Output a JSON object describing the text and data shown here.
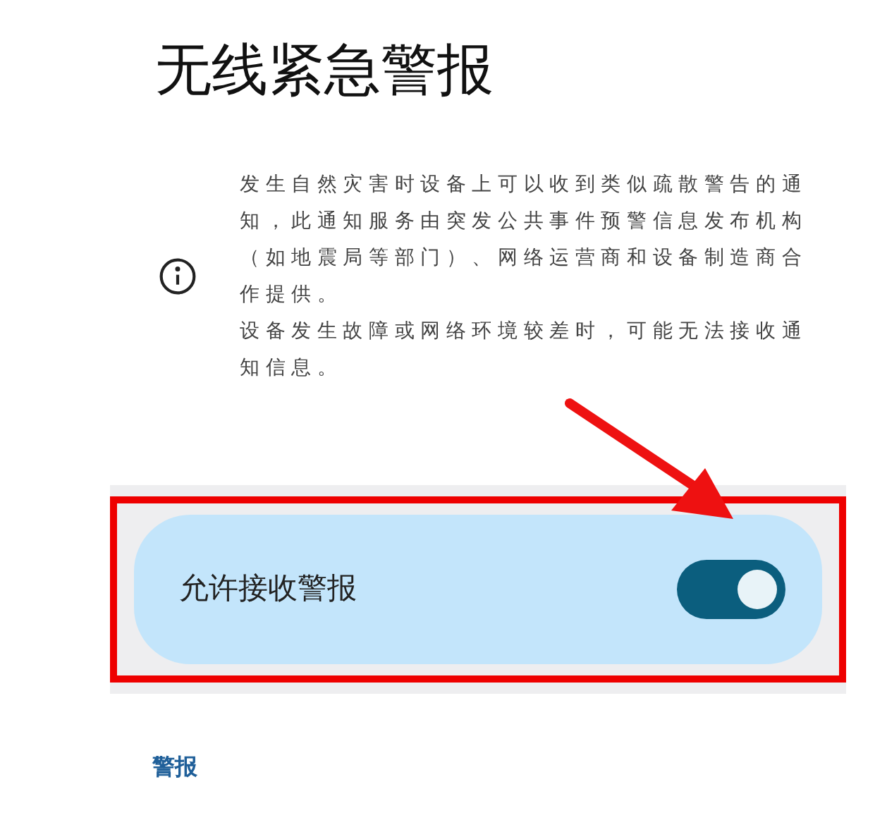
{
  "title": "无线紧急警报",
  "info": [
    "发生自然灾害时设备上可以收到类似疏散警告的通知，此通知服务由突发公共事件预警信息发布机构（如地震局等部门）、网络运营商和设备制造商合作提供。",
    "设备发生故障或网络环境较差时，可能无法接收通知信息。"
  ],
  "toggle": {
    "label": "允许接收警报",
    "on": true
  },
  "section_header": "警报"
}
